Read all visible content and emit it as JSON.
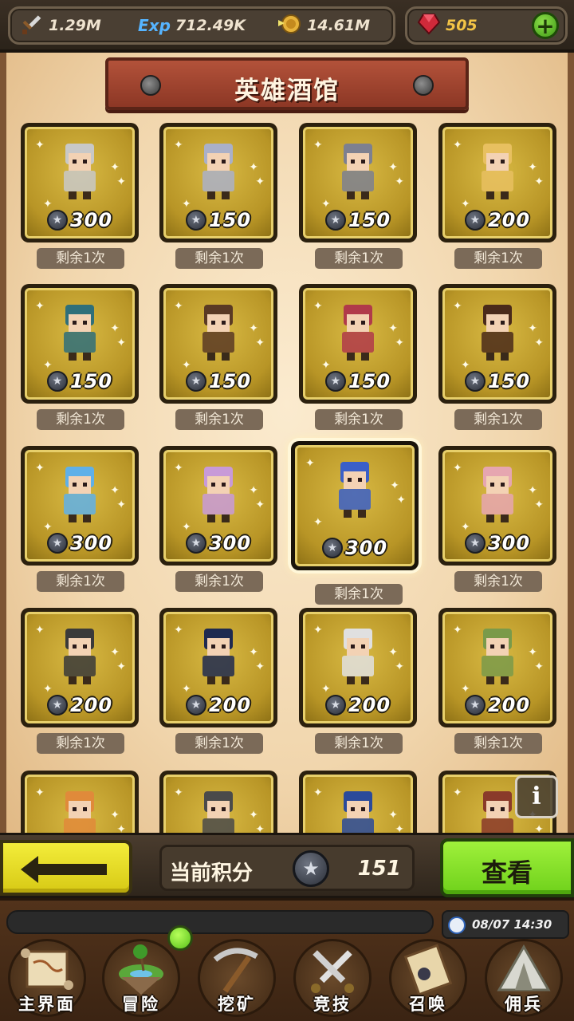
{
  "resources": {
    "attack": "1.29M",
    "exp": "712.49K",
    "gold": "14.61M",
    "gems": "505",
    "exp_icon_text": "Exp"
  },
  "title": "英雄酒馆",
  "heroes": [
    {
      "cost": "300",
      "remaining": "剩余1次",
      "color": "#c8c8c8"
    },
    {
      "cost": "150",
      "remaining": "剩余1次",
      "color": "#aab0c8"
    },
    {
      "cost": "150",
      "remaining": "剩余1次",
      "color": "#7d8090"
    },
    {
      "cost": "200",
      "remaining": "剩余1次",
      "color": "#e8c060"
    },
    {
      "cost": "150",
      "remaining": "剩余1次",
      "color": "#2f6f7a"
    },
    {
      "cost": "150",
      "remaining": "剩余1次",
      "color": "#5a3a24"
    },
    {
      "cost": "150",
      "remaining": "剩余1次",
      "color": "#b03a4a"
    },
    {
      "cost": "150",
      "remaining": "剩余1次",
      "color": "#4a2a1a"
    },
    {
      "cost": "300",
      "remaining": "剩余1次",
      "color": "#5fb0e8"
    },
    {
      "cost": "300",
      "remaining": "剩余1次",
      "color": "#c89ad8"
    },
    {
      "cost": "300",
      "remaining": "剩余1次",
      "color": "#3a5fc8"
    },
    {
      "cost": "300",
      "remaining": "剩余1次",
      "color": "#e6a6b0"
    },
    {
      "cost": "200",
      "remaining": "剩余1次",
      "color": "#3a3a3a"
    },
    {
      "cost": "200",
      "remaining": "剩余1次",
      "color": "#1e2a50"
    },
    {
      "cost": "200",
      "remaining": "剩余1次",
      "color": "#e0e0e0"
    },
    {
      "cost": "200",
      "remaining": "剩余1次",
      "color": "#7a9a4a"
    },
    {
      "cost": "",
      "remaining": "",
      "color": "#e08a3a"
    },
    {
      "cost": "",
      "remaining": "",
      "color": "#4a4a4a"
    },
    {
      "cost": "",
      "remaining": "",
      "color": "#2a4a9a"
    },
    {
      "cost": "",
      "remaining": "",
      "color": "#8a3a2a"
    }
  ],
  "info_label": "i",
  "action_bar": {
    "score_label": "当前积分",
    "score_value": "151",
    "view_label": "查看"
  },
  "clock": "08/07 14:30",
  "nav": [
    {
      "label": "主界面",
      "icon": "map-scroll-icon"
    },
    {
      "label": "冒险",
      "icon": "floating-island-icon"
    },
    {
      "label": "挖矿",
      "icon": "pickaxe-icon"
    },
    {
      "label": "竞技",
      "icon": "crossed-swords-icon"
    },
    {
      "label": "召唤",
      "icon": "summon-scroll-icon"
    },
    {
      "label": "佣兵",
      "icon": "tent-icon"
    }
  ]
}
